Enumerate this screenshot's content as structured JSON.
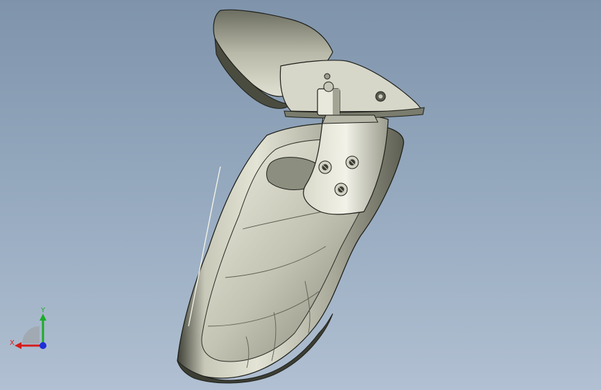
{
  "viewport": {
    "background_top": "#7f94ab",
    "background_bottom": "#b1c0d2"
  },
  "model": {
    "description_icon": "armrest-part-icon",
    "body_color": "#c9c9b9",
    "shadow_color": "#4a4c40",
    "edge_color": "#1e1f1a"
  },
  "triad": {
    "x_label": "X",
    "y_label": "Y",
    "x_color": "#d41c1c",
    "y_color": "#1dab2a",
    "z_color": "#1f2fd6"
  }
}
